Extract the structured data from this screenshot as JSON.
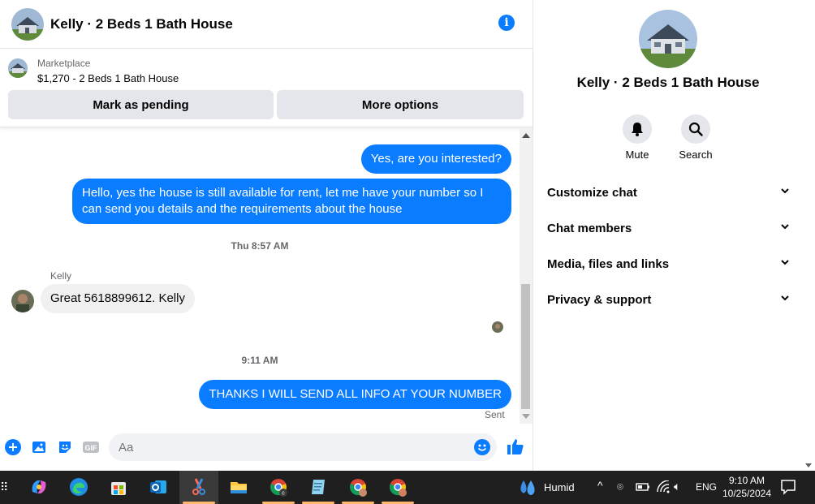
{
  "chat": {
    "title": "Kelly · 2 Beds 1 Bath House",
    "marketplace": {
      "label": "Marketplace",
      "listing": "$1,270 - 2 Beds 1 Bath House",
      "pending_button": "Mark as pending",
      "more_button": "More options"
    },
    "messages": [
      {
        "direction": "out",
        "text": "Yes, are you interested?"
      },
      {
        "direction": "out",
        "text": "Hello, yes the house is still available for rent, let me have your number so I can send you details and the requirements about the house"
      },
      {
        "timestamp": "Thu 8:57 AM"
      },
      {
        "sender": "Kelly",
        "direction": "in",
        "text": "Great 5618899612. Kelly"
      },
      {
        "timestamp": "9:11 AM"
      },
      {
        "direction": "out",
        "text": "THANKS I WILL SEND ALL INFO AT YOUR NUMBER",
        "status": "Sent"
      }
    ],
    "composer": {
      "placeholder": "Aa"
    }
  },
  "sidebar": {
    "title": "Kelly · 2 Beds 1 Bath House",
    "actions": [
      {
        "label": "Mute",
        "icon": "bell-icon"
      },
      {
        "label": "Search",
        "icon": "search-icon"
      }
    ],
    "sections": [
      {
        "label": "Customize chat"
      },
      {
        "label": "Chat members"
      },
      {
        "label": "Media, files and links"
      },
      {
        "label": "Privacy & support"
      }
    ]
  },
  "taskbar": {
    "weather": "Humid",
    "language": "ENG",
    "time": "9:10 AM",
    "date": "10/25/2024"
  },
  "colors": {
    "accent": "#0a7cff",
    "incoming_bubble": "#f0f0f0",
    "button_bg": "#e4e6eb",
    "taskbar": "#1f1f1f"
  }
}
